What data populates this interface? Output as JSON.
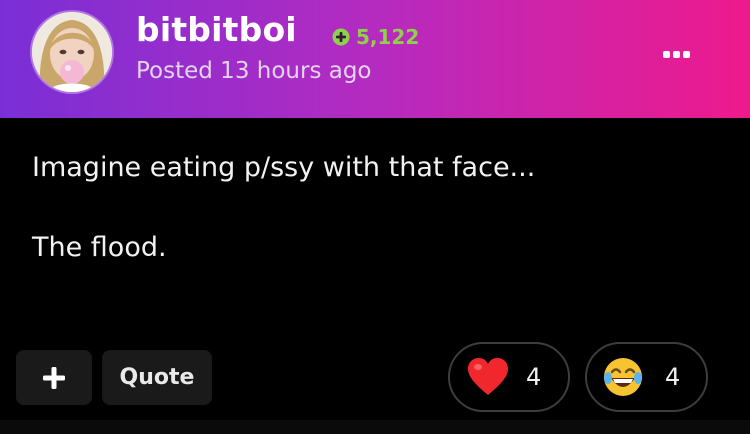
{
  "post": {
    "username": "bitbitboi",
    "reputation": "5,122",
    "posted_time": "Posted 13 hours ago",
    "content": [
      "Imagine eating p/ssy with that face...",
      "The flood."
    ]
  },
  "actions": {
    "add_label": "+",
    "quote_label": "Quote"
  },
  "reactions": [
    {
      "icon": "heart-icon",
      "count": "4"
    },
    {
      "icon": "laughing-emoji-icon",
      "count": "4"
    }
  ],
  "colors": {
    "header_gradient_start": "#7a2fd6",
    "header_gradient_end": "#ee1a8c",
    "reputation": "#8fd14a",
    "background": "#000000"
  }
}
